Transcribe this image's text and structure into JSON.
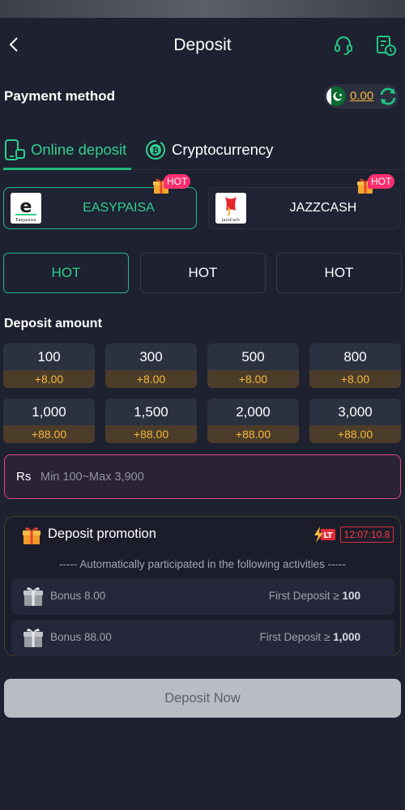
{
  "header": {
    "title": "Deposit",
    "back_icon": "chevron-left-icon",
    "support_icon": "headset-icon",
    "history_icon": "history-icon"
  },
  "payment": {
    "label": "Payment method",
    "balance": "0.00",
    "currency_flag": "pakistan-flag-icon"
  },
  "tabs": [
    {
      "label": "Online deposit",
      "icon": "phone-icon",
      "active": true
    },
    {
      "label": "Cryptocurrency",
      "icon": "bitcoin-icon",
      "active": false
    }
  ],
  "channels": [
    {
      "name": "EASYPAISA",
      "logo_text": "Easypaisa",
      "badge": "HOT",
      "active": true
    },
    {
      "name": "JAZZCASH",
      "logo_text": "JazzCash",
      "badge": "HOT",
      "active": false
    }
  ],
  "subtabs": [
    {
      "label": "HOT",
      "active": true
    },
    {
      "label": "HOT",
      "active": false
    },
    {
      "label": "HOT",
      "active": false
    }
  ],
  "amounts": {
    "title": "Deposit amount",
    "items": [
      {
        "amount": "100",
        "bonus": "+8.00"
      },
      {
        "amount": "300",
        "bonus": "+8.00"
      },
      {
        "amount": "500",
        "bonus": "+8.00"
      },
      {
        "amount": "800",
        "bonus": "+8.00"
      },
      {
        "amount": "1,000",
        "bonus": "+88.00"
      },
      {
        "amount": "1,500",
        "bonus": "+88.00"
      },
      {
        "amount": "2,000",
        "bonus": "+88.00"
      },
      {
        "amount": "3,000",
        "bonus": "+88.00"
      }
    ]
  },
  "input": {
    "currency": "Rs",
    "placeholder": "Min 100~Max 3,900",
    "value": ""
  },
  "promotion": {
    "title": "Deposit promotion",
    "timer_badge": "LT",
    "timer": "12:07:10.8",
    "note": "----- Automatically participated in the following activities -----",
    "rows": [
      {
        "bonus": "Bonus 8.00",
        "condition": "First Deposit ≥",
        "threshold": "100"
      },
      {
        "bonus": "Bonus 88.00",
        "condition": "First Deposit ≥",
        "threshold": "1,000"
      }
    ]
  },
  "deposit_button": "Deposit Now",
  "colors": {
    "background": "#1d2130",
    "accent": "#2fcf8e",
    "bonus": "#f6b73c",
    "hot": "#ff2f6f",
    "input_border": "#e0497f"
  }
}
